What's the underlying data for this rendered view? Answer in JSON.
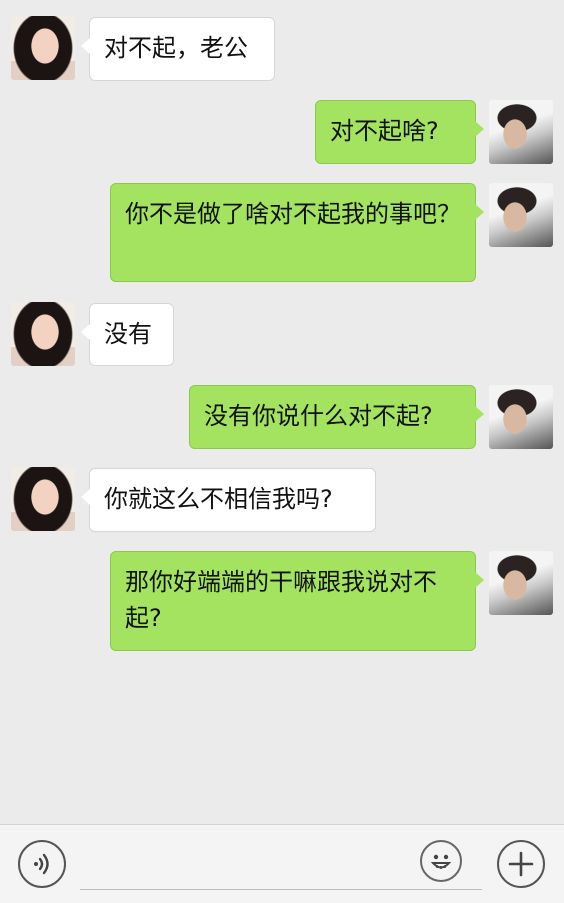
{
  "messages": [
    {
      "from": "her",
      "text": "对不起，老公"
    },
    {
      "from": "me",
      "text": "对不起啥?"
    },
    {
      "from": "me",
      "text": "你不是做了啥对不起我的事吧？"
    },
    {
      "from": "her",
      "text": "没有"
    },
    {
      "from": "me",
      "text": "没有你说什么对不起?"
    },
    {
      "from": "her",
      "text": "你就这么不相信我吗?"
    },
    {
      "from": "me",
      "text": "那你好端端的干嘛跟我说对不起?"
    }
  ],
  "input": {
    "value": ""
  },
  "icons": {
    "voice": "voice-icon",
    "emoji": "emoji-icon",
    "more": "plus-icon"
  }
}
